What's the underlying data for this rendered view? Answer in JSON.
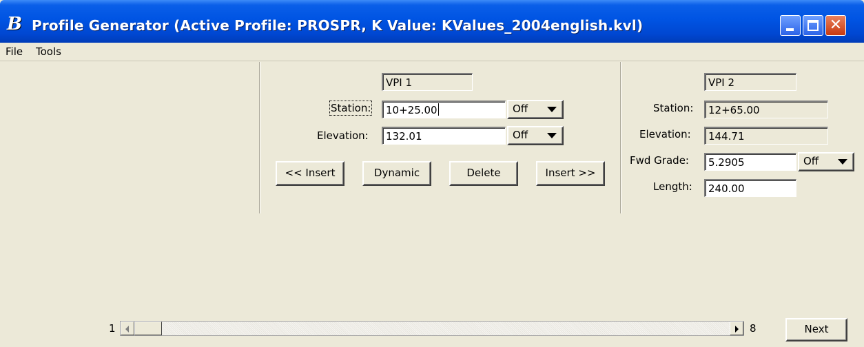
{
  "window": {
    "title": "Profile Generator  (Active Profile: PROSPR,  K Value: KValues_2004english.kvl)",
    "app_icon": "B"
  },
  "menu": {
    "file": "File",
    "tools": "Tools"
  },
  "vpi1": {
    "title": "VPI 1",
    "station_label": "Station:",
    "station_value": "10+25.00",
    "station_lock": "Off",
    "elevation_label": "Elevation:",
    "elevation_value": "132.01",
    "elevation_lock": "Off"
  },
  "buttons": {
    "insert_before": "<< Insert",
    "dynamic": "Dynamic",
    "delete": "Delete",
    "insert_after": "Insert >>"
  },
  "vpi2": {
    "title": "VPI 2",
    "station_label": "Station:",
    "station_value": "12+65.00",
    "elevation_label": "Elevation:",
    "elevation_value": "144.71",
    "fwd_grade_label": "Fwd Grade:",
    "fwd_grade_value": "5.2905",
    "fwd_grade_lock": "Off",
    "length_label": "Length:",
    "length_value": "240.00"
  },
  "navigation": {
    "min": "1",
    "max": "8",
    "position": 1,
    "next_label": "Next"
  }
}
